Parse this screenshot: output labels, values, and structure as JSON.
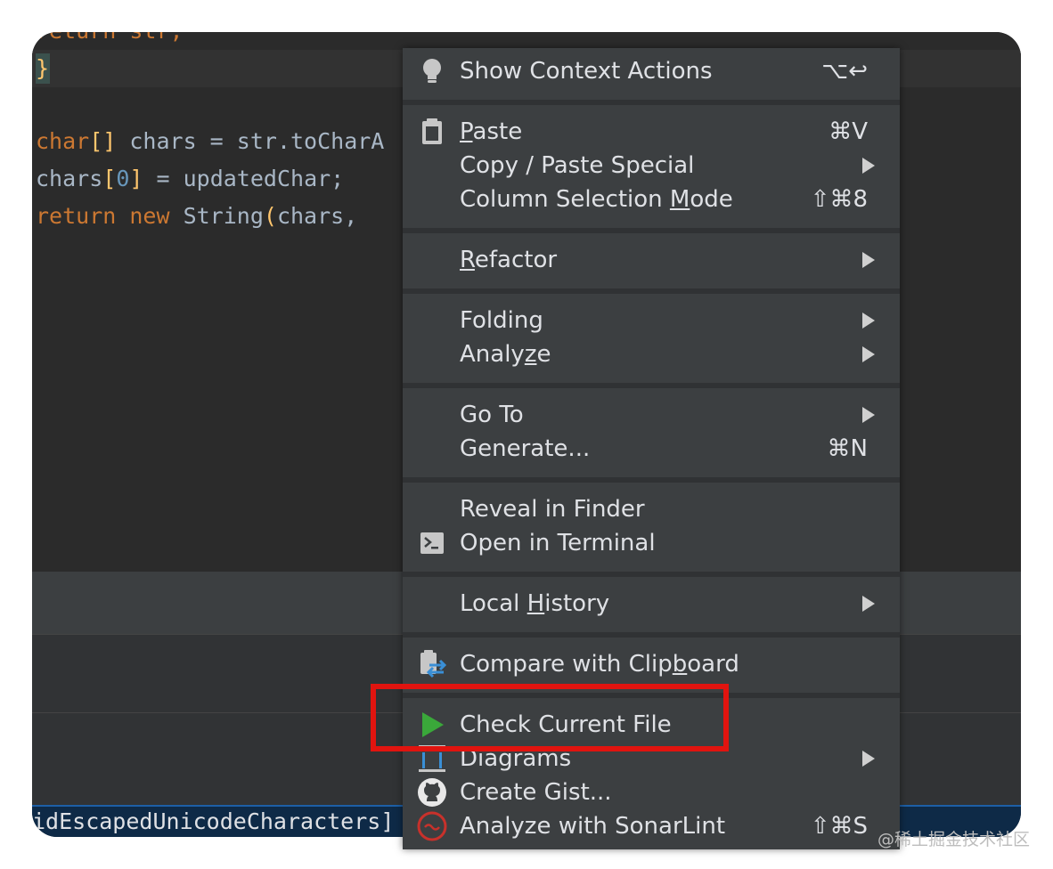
{
  "editor": {
    "line_top": "return str;",
    "line_brace": "}",
    "line1": {
      "kw": "char",
      "p1": "[]",
      "text": " chars = str.toCharA"
    },
    "line2": {
      "a": "chars",
      "b": "[",
      "num": "0",
      "c": "]",
      "d": " = updatedChar;"
    },
    "line3": {
      "kw1": "return",
      "kw2": "new",
      "text": " String",
      "paren": "(",
      "rest": "chars, "
    }
  },
  "status_bar": {
    "text": "idEscapedUnicodeCharacters]"
  },
  "context_menu": {
    "show_context_actions": {
      "label": "Show Context Actions",
      "shortcut": "⌥↩"
    },
    "paste": {
      "mnemonic": "P",
      "rest": "aste",
      "shortcut": "⌘V"
    },
    "copy_paste_special": {
      "label": "Copy / Paste Special"
    },
    "column_selection": {
      "pre": "Column Selection ",
      "mnemonic": "M",
      "post": "ode",
      "shortcut": "⇧⌘8"
    },
    "refactor": {
      "mnemonic": "R",
      "rest": "efactor"
    },
    "folding": {
      "label": "Folding"
    },
    "analyze": {
      "pre": "Analy",
      "mnemonic": "z",
      "post": "e"
    },
    "go_to": {
      "label": "Go To"
    },
    "generate": {
      "label": "Generate...",
      "shortcut": "⌘N"
    },
    "reveal_in_finder": {
      "label": "Reveal in Finder"
    },
    "open_in_terminal": {
      "label": "Open in Terminal"
    },
    "local_history": {
      "pre": "Local ",
      "mnemonic": "H",
      "post": "istory"
    },
    "compare_clipboard": {
      "pre": "Compare with Clip",
      "mnemonic": "b",
      "post": "oard"
    },
    "check_current_file": {
      "label": "Check Current File"
    },
    "diagrams": {
      "label": "Diagrams"
    },
    "create_gist": {
      "label": "Create Gist..."
    },
    "sonarlint": {
      "label": "Analyze with SonarLint",
      "shortcut": "⇧⌘S"
    }
  },
  "watermark": "@稀土掘金技术社区",
  "colors": {
    "highlight_box": "#e1140f",
    "run_icon": "#3aa83a",
    "sonar_icon": "#c8312b"
  }
}
